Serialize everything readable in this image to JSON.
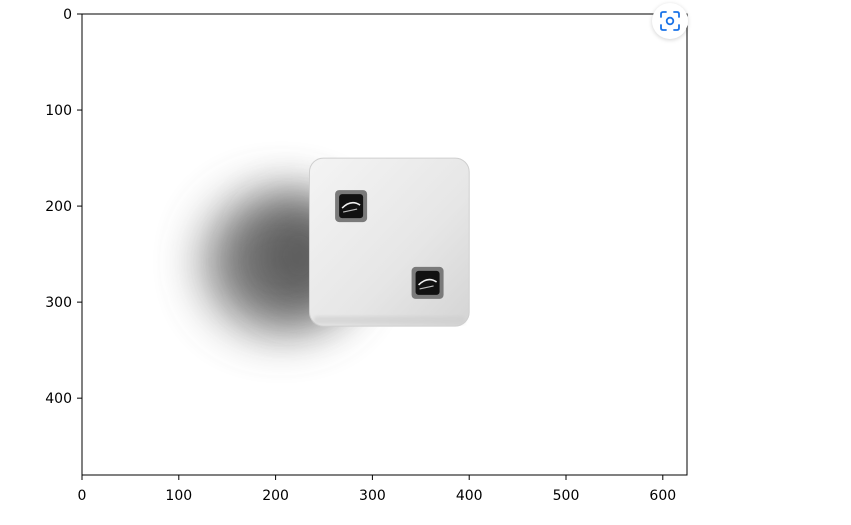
{
  "chart_data": {
    "type": "image",
    "title": "",
    "xlabel": "",
    "ylabel": "",
    "xlim": [
      0,
      625
    ],
    "ylim": [
      480,
      0
    ],
    "xticks": [
      0,
      100,
      200,
      300,
      400,
      500,
      600
    ],
    "yticks": [
      0,
      100,
      200,
      300,
      400
    ],
    "grid": false,
    "image_content": {
      "die_face_x": [
        235,
        400
      ],
      "die_face_y": [
        150,
        325
      ],
      "pips": [
        {
          "x": 278,
          "y": 200
        },
        {
          "x": 357,
          "y": 280
        }
      ],
      "face_color": "#e8e8e8",
      "pip_color": "#111111",
      "shadow_color": "#5a5a5a"
    }
  },
  "overlay": {
    "lens_icon": "visual-search-icon",
    "accent": "#1a73e8"
  }
}
